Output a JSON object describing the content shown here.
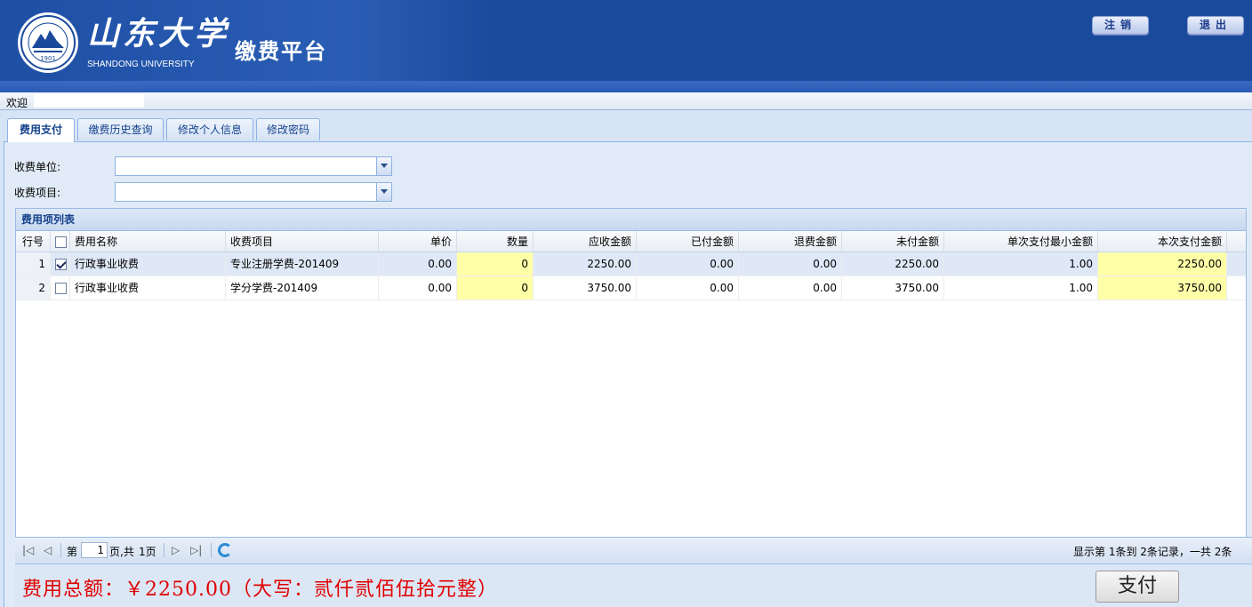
{
  "header": {
    "brand_cn": "山东大学",
    "brand_en": "SHANDONG UNIVERSITY",
    "seal_year": "1901",
    "platform": "缴费平台",
    "logout_label": "注销",
    "exit_label": "退出",
    "colors": {
      "header_bg": "#1a4a9c",
      "button_text": "#1a3a8a"
    }
  },
  "welcome": "欢迎",
  "tabs": [
    {
      "label": "费用支付",
      "active": true
    },
    {
      "label": "缴费历史查询",
      "active": false
    },
    {
      "label": "修改个人信息",
      "active": false
    },
    {
      "label": "修改密码",
      "active": false
    }
  ],
  "form": {
    "unit_label": "收费单位:",
    "unit_value": "",
    "item_label": "收费项目:",
    "item_value": ""
  },
  "grid": {
    "title": "费用项列表",
    "headers": [
      "行号",
      "",
      "费用名称",
      "收费项目",
      "单价",
      "数量",
      "应收金额",
      "已付金额",
      "退费金额",
      "未付金额",
      "单次支付最小金额",
      "本次支付金额"
    ],
    "rows": [
      {
        "no": "1",
        "checked": true,
        "name": "行政事业收费",
        "item": "专业注册学费-201409",
        "price": "0.00",
        "qty": "0",
        "receivable": "2250.00",
        "paid": "0.00",
        "refund": "0.00",
        "unpaid": "2250.00",
        "min_pay": "1.00",
        "pay_now": "2250.00"
      },
      {
        "no": "2",
        "checked": false,
        "name": "行政事业收费",
        "item": "学分学费-201409",
        "price": "0.00",
        "qty": "0",
        "receivable": "3750.00",
        "paid": "0.00",
        "refund": "0.00",
        "unpaid": "3750.00",
        "min_pay": "1.00",
        "pay_now": "3750.00"
      }
    ]
  },
  "pager": {
    "page_prefix": "第",
    "page_value": "1",
    "page_suffix": "页,共",
    "total_pages": "1页",
    "summary": "显示第 1条到 2条记录，一共 2条"
  },
  "footer": {
    "total_text": "费用总额：￥2250.00（大写：贰仟贰佰伍拾元整）",
    "pay_label": "支付",
    "total_color": "#e00000"
  }
}
